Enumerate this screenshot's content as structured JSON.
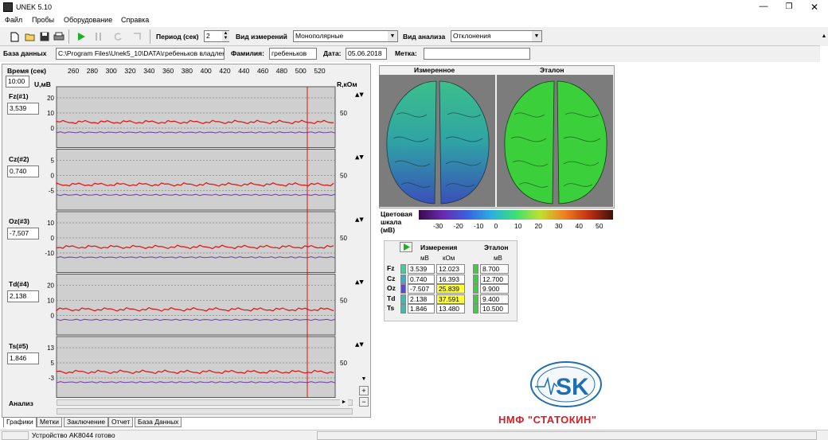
{
  "window": {
    "title": "UNEK 5.10"
  },
  "menu": [
    "Файл",
    "Пробы",
    "Оборудование",
    "Справка"
  ],
  "toolbar": {
    "period_label": "Период (сек)",
    "period_value": "2",
    "meas_type_label": "Вид измерений",
    "meas_type_value": "Монополярные",
    "analysis_type_label": "Вид анализа",
    "analysis_type_value": "Отклонения"
  },
  "info": {
    "db_label": "База данных",
    "db_path": "C:\\Program Files\\Unek5_10\\DATA\\гребеньков владлен",
    "surname_label": "Фамилия:",
    "surname_value": "гребеньков",
    "date_label": "Дата:",
    "date_value": "05.06.2018",
    "mark_label": "Метка:",
    "mark_value": ""
  },
  "graph": {
    "time_label": "Время (сек)",
    "time_value": "10:00",
    "unit_left": "U,мВ",
    "unit_right": "R,кОм",
    "time_ticks": [
      "260",
      "280",
      "300",
      "320",
      "340",
      "360",
      "380",
      "400",
      "420",
      "440",
      "460",
      "480",
      "500",
      "520"
    ],
    "analysis_label": "Анализ",
    "channels": [
      {
        "name": "Fz(#1)",
        "value": "3,539",
        "yticks": [
          "20",
          "10",
          "0"
        ],
        "rtick": "50"
      },
      {
        "name": "Cz(#2)",
        "value": "0,740",
        "yticks": [
          "5",
          "0",
          "-5"
        ],
        "rtick": "50"
      },
      {
        "name": "Oz(#3)",
        "value": "-7,507",
        "yticks": [
          "10",
          "0",
          "-10"
        ],
        "rtick": "50"
      },
      {
        "name": "Td(#4)",
        "value": "2,138",
        "yticks": [
          "20",
          "10",
          "0"
        ],
        "rtick": "50"
      },
      {
        "name": "Ts(#5)",
        "value": "1,846",
        "yticks": [
          "13",
          "5",
          "-3"
        ],
        "rtick": "50"
      }
    ]
  },
  "brain": {
    "measured_label": "Измеренное",
    "reference_label": "Эталон",
    "scale_label": [
      "Цветовая",
      "шкала",
      "(мВ)"
    ],
    "scale_ticks": [
      "-30",
      "-20",
      "-10",
      "0",
      "10",
      "20",
      "30",
      "40",
      "50"
    ]
  },
  "table": {
    "h_meas": "Измерения",
    "h_ref": "Эталон",
    "u_mv": "мВ",
    "u_kohm": "кОм",
    "u_mv2": "мВ",
    "rows": [
      {
        "name": "Fz",
        "mv": "3.539",
        "kohm": "12.023",
        "ref": "8.700",
        "c1": "#53c59b",
        "hl": false
      },
      {
        "name": "Cz",
        "mv": "0.740",
        "kohm": "16.393",
        "ref": "12.700",
        "c1": "#4ea5b8",
        "hl": false
      },
      {
        "name": "Oz",
        "mv": "-7.507",
        "kohm": "25.839",
        "ref": "9.900",
        "c1": "#5a4fc2",
        "hl": true
      },
      {
        "name": "Td",
        "mv": "2.138",
        "kohm": "37.591",
        "ref": "9.400",
        "c1": "#4fb5aa",
        "hl": true
      },
      {
        "name": "Ts",
        "mv": "1.846",
        "kohm": "13.480",
        "ref": "10.500",
        "c1": "#52b1a6",
        "hl": false
      }
    ]
  },
  "logo": {
    "text": "НМФ \"СТАТОКИН\"",
    "brand_color": "#1f6fb0",
    "text_color": "#d0202a"
  },
  "tabs": [
    "Графики",
    "Метки",
    "Заключение",
    "Отчет",
    "База Данных"
  ],
  "status": {
    "text": "Устройство AK8044 готово"
  }
}
